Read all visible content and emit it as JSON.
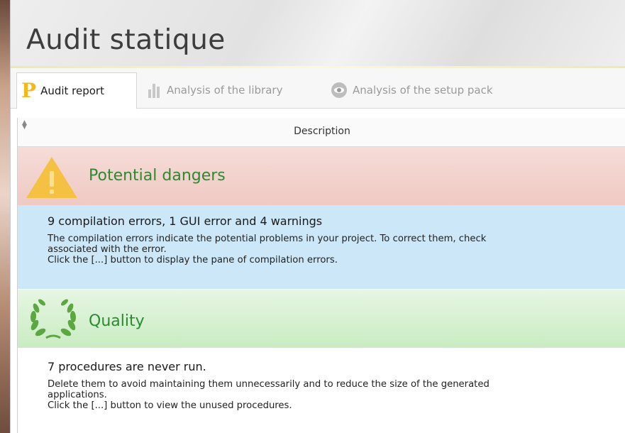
{
  "app": {
    "title": "Audit statique"
  },
  "tabs": [
    {
      "label": "Audit report",
      "icon": "p-logo-icon",
      "active": true
    },
    {
      "label": "Analysis of the library",
      "icon": "library-bars-icon",
      "active": false
    },
    {
      "label": "Analysis of the setup pack",
      "icon": "eye-icon",
      "active": false
    }
  ],
  "table": {
    "column_header": "Description",
    "sections": [
      {
        "title": "Potential dangers",
        "icon": "warning-icon",
        "color": "#2c8a30",
        "item": {
          "title": "9 compilation errors, 1 GUI error and 4 warnings",
          "text": "The compilation errors indicate the potential problems in your project. To correct them, check\nassociated with the error.\nClick the [...] button to display the pane of compilation errors."
        }
      },
      {
        "title": "Quality",
        "icon": "laurel-icon",
        "color": "#2c8a30",
        "item": {
          "title": "7 procedures are never run.",
          "text": "Delete them to avoid maintaining them unnecessarily and to reduce the size of the generated\napplications.\nClick the [...] button to view the unused procedures."
        }
      }
    ]
  },
  "colors": {
    "accent": "#f2b81c",
    "danger_bg": "#f0c9c3",
    "info_bg": "#cce7f7",
    "quality_bg": "#c9ecc2"
  }
}
